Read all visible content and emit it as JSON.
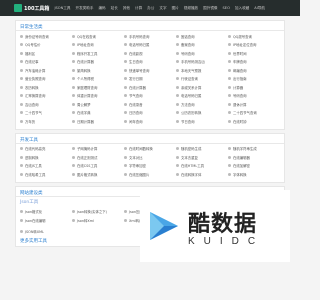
{
  "topbar": {
    "logo_text": "100工具箱",
    "nav": [
      "JSON工具",
      "开发类助手",
      "编码",
      "站长",
      "其他",
      "计算",
      "办公",
      "文字",
      "图片",
      "视频播放",
      "国外镜像",
      "SEO",
      "加入收藏",
      "AI导航"
    ]
  },
  "sections": [
    {
      "title": "日常生活类",
      "items": [
        "身份证号码查询",
        "QQ在线查询",
        "手机号码查询",
        "固话查询",
        "QQ靓号查询",
        "QQ号估价",
        "IP地址查询",
        "电话号码归属",
        "备案查询",
        "IP地址定位查询",
        "福利区",
        "程序开发工具",
        "在线影视",
        "号码查询",
        "世界时间",
        "在线记事",
        "在线计算器",
        "生日查询",
        "手机号码测吉凶",
        "车牌查询",
        "汽车油耗计算",
        "繁简转换",
        "快递单号查询",
        "本地天气预报",
        "邮编查询",
        "营业执照查询",
        "个人所得税",
        "发行日期",
        "行驶证查询",
        "出行指南",
        "农历转换",
        "家庭理财查询",
        "在线计算器",
        "亲戚关系计算",
        "计算器",
        "汇率换算查询",
        "体重计算查询",
        "节气查询",
        "电话号码归属",
        "号码查询",
        "吉凶查询",
        "周公解梦",
        "在线录音",
        "方法查询",
        "退休计算",
        "二十四节气",
        "在线字典",
        "日历查询",
        "公历农历转换",
        "二十四节气查询",
        "万年历",
        "日期计算器",
        "闰年查询",
        "节日查询",
        "在线时钟"
      ]
    },
    {
      "title": "开发工具",
      "items": [
        "在线代码高亮",
        "子网掩码计算",
        "在线时间戳转换",
        "随机密码生成",
        "随机字符串生成",
        "进制转换",
        "在线正则测试",
        "文本对比",
        "文本去重复",
        "在线编辑器",
        "在线JS工具",
        "在线CSS工具",
        "字符串加密",
        "在线HTML工具",
        "在线加解密",
        "在线哈希工具",
        "图片格式转换",
        "在线压缩图片",
        "在线转换字体",
        "字体转换"
      ]
    },
    {
      "title": "网站建设类",
      "json_title": "Json工具",
      "items": [
        "Json格式化",
        "Json转换(实体之下)",
        "Json压缩",
        "Json转CSV",
        "Json生成Java实体类",
        "Json在线编辑",
        "Json转Xml",
        "Xml转Json",
        "在线JSON格式化",
        "Excel(CSV)转Json格式"
      ],
      "extra": "JSON转XML"
    }
  ],
  "more_title": "更多实用工具",
  "watermark": {
    "cn": "酷数据",
    "en": "KUIDC"
  }
}
